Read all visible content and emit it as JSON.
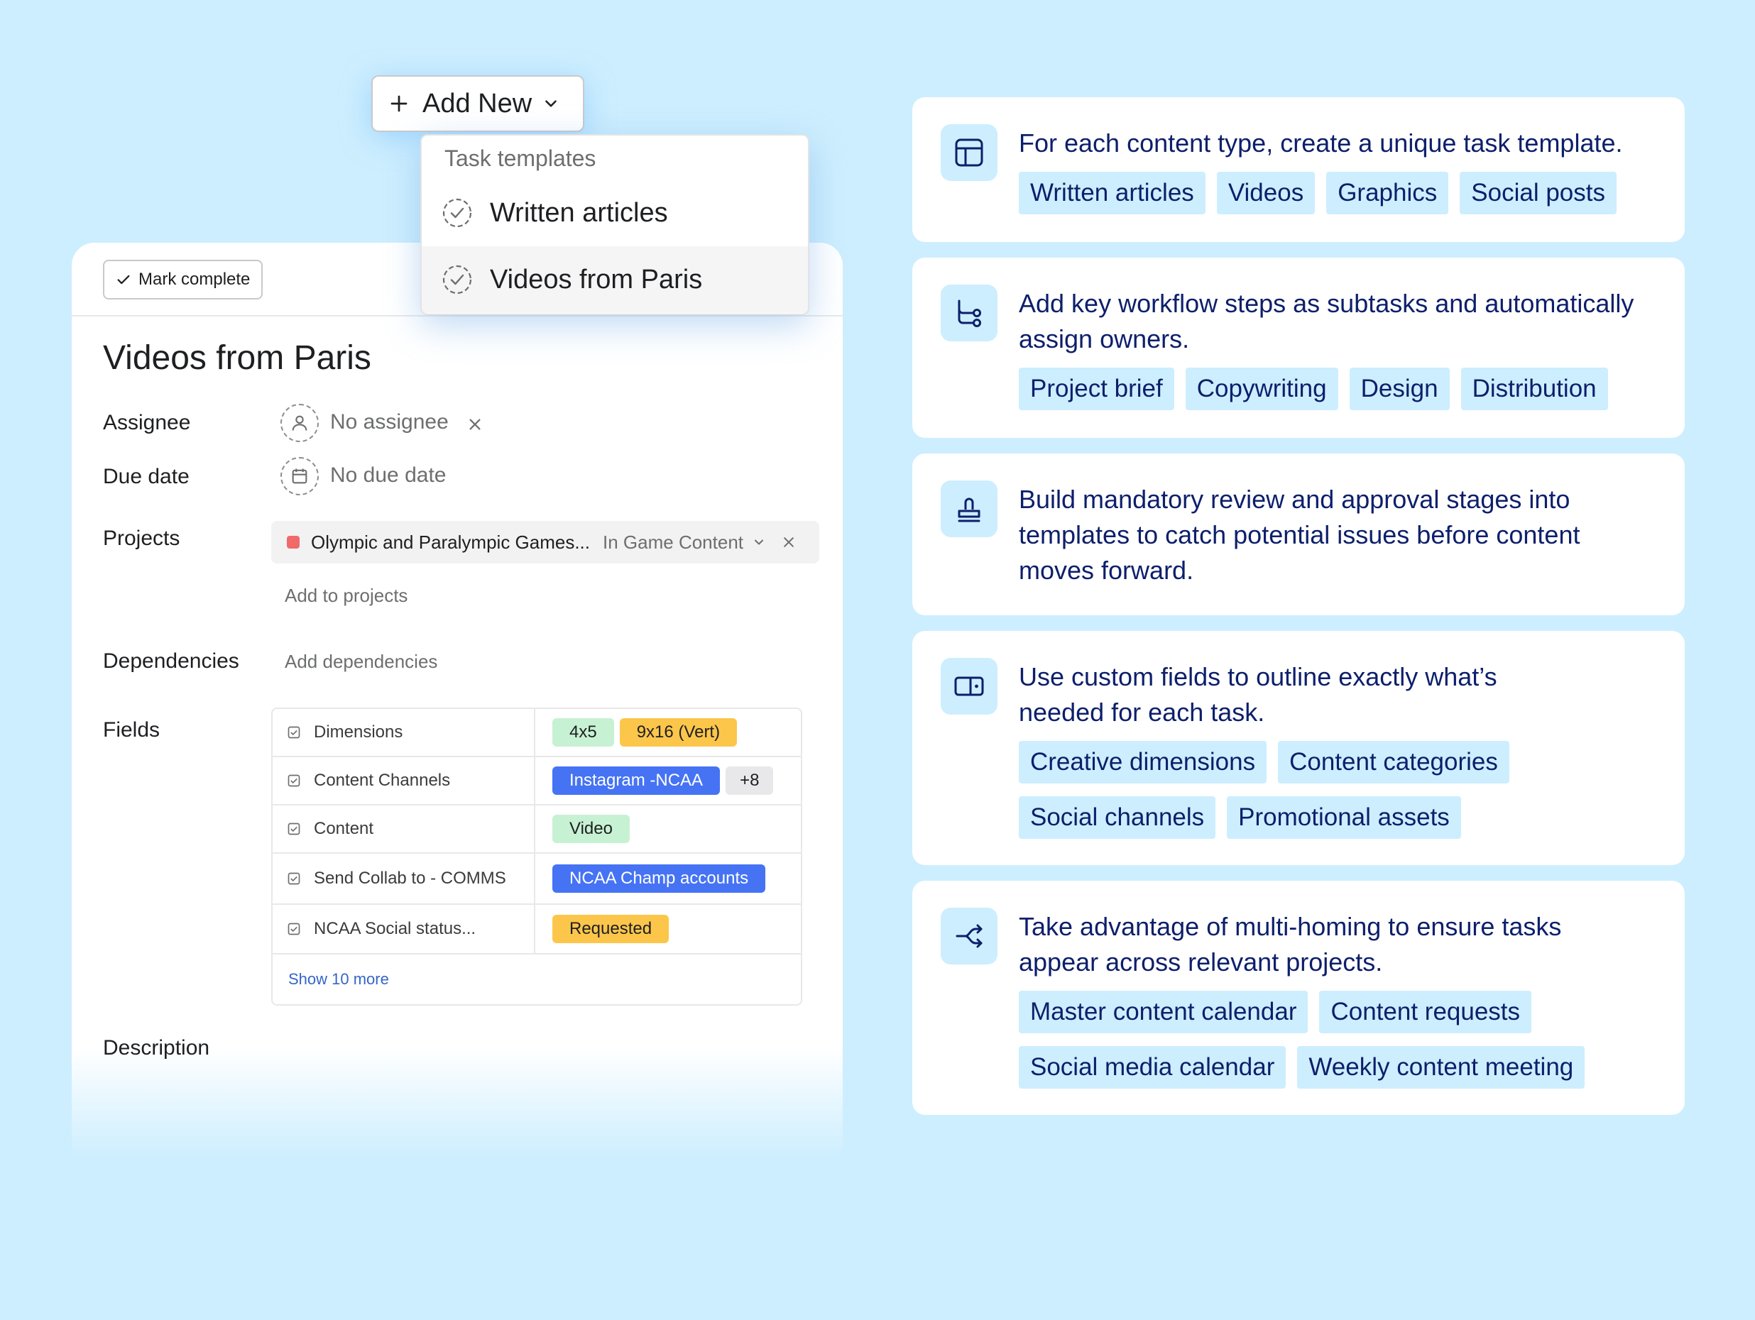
{
  "add_new": {
    "label": "Add New"
  },
  "dropdown": {
    "header": "Task templates",
    "items": [
      {
        "label": "Written articles"
      },
      {
        "label": "Videos from Paris"
      }
    ]
  },
  "task": {
    "mark_complete": "Mark complete",
    "title": "Videos from Paris",
    "labels": {
      "assignee": "Assignee",
      "due_date": "Due date",
      "projects": "Projects",
      "dependencies": "Dependencies",
      "fields": "Fields",
      "description": "Description"
    },
    "assignee_value": "No assignee",
    "due_date_value": "No due date",
    "project": {
      "name": "Olympic and Paralympic Games...",
      "section": "In Game Content",
      "color": "#f06a6a"
    },
    "add_to_projects": "Add to projects",
    "add_dependencies": "Add dependencies",
    "fields": [
      {
        "name": "Dimensions",
        "values": [
          {
            "text": "4x5",
            "color": "green"
          },
          {
            "text": "9x16 (Vert)",
            "color": "yellow"
          }
        ]
      },
      {
        "name": "Content Channels",
        "values": [
          {
            "text": "Instagram -NCAA",
            "color": "blue"
          },
          {
            "text": "+8",
            "color": "gray"
          }
        ]
      },
      {
        "name": "Content",
        "values": [
          {
            "text": "Video",
            "color": "green"
          }
        ]
      },
      {
        "name": "Send Collab to - COMMS",
        "values": [
          {
            "text": "NCAA Champ accounts",
            "color": "blue"
          }
        ]
      },
      {
        "name": "NCAA Social status...",
        "values": [
          {
            "text": "Requested",
            "color": "yellow"
          }
        ]
      }
    ],
    "show_more": "Show 10 more"
  },
  "cards": [
    {
      "icon": "layout-icon",
      "text": "For each content type, create a unique task template.",
      "tags": [
        "Written articles",
        "Videos",
        "Graphics",
        "Social posts"
      ]
    },
    {
      "icon": "subtasks-icon",
      "text": "Add key workflow steps as subtasks and automatically assign owners.",
      "tags": [
        "Project brief",
        "Copywriting",
        "Design",
        "Distribution"
      ]
    },
    {
      "icon": "approval-stamp-icon",
      "text": "Build mandatory review and approval stages into templates to catch potential issues before content moves forward.",
      "tags": []
    },
    {
      "icon": "custom-field-icon",
      "text": "Use custom fields to outline exactly what’s needed for each task.",
      "tags": [
        "Creative dimensions",
        "Content categories",
        "Social channels",
        "Promotional assets"
      ]
    },
    {
      "icon": "multi-home-icon",
      "text": "Take advantage of multi-homing to ensure tasks appear across relevant projects.",
      "tags": [
        "Master content calendar",
        "Content requests",
        "Social media calendar",
        "Weekly content meeting"
      ]
    }
  ],
  "colors": {
    "background": "#cdeefe",
    "card_text": "#0d1f6b",
    "chip_blue": "#4573f4",
    "chip_yellow": "#fcc64b",
    "chip_green": "#c7f1d3"
  }
}
